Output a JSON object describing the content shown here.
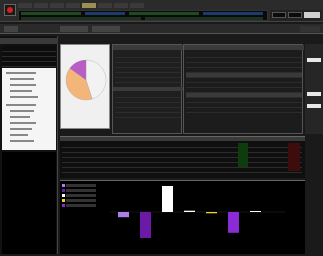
{
  "app": {
    "title": "",
    "logo": "red-dot"
  },
  "menu": {
    "items": [
      "",
      "",
      "",
      "",
      "",
      "",
      "",
      ""
    ],
    "active_index": 4
  },
  "ticker": {
    "rows": [
      "",
      ""
    ]
  },
  "tabs": [
    "",
    "",
    ""
  ],
  "colors": {
    "pie_white": "#f2f2f2",
    "pie_orange": "#f4b57a",
    "pie_purple": "#b95cc6",
    "bar_purple_light": "#a880e8",
    "bar_purple_dark": "#6b1aa8",
    "bar_white": "#ffffff",
    "bar_yellow": "#f0d020",
    "bar_purple_mid": "#8a2bd6",
    "green": "#2bd02b",
    "red": "#e03b3b"
  },
  "chart_data": {
    "type": "bar",
    "categories": [
      "",
      "",
      "",
      "",
      "",
      "",
      ""
    ],
    "values": [
      -0.2,
      -1.0,
      1.0,
      0.05,
      -0.05,
      -0.8,
      0.02
    ]
  },
  "pie": {
    "slices": [
      0.45,
      0.4,
      0.15
    ]
  }
}
